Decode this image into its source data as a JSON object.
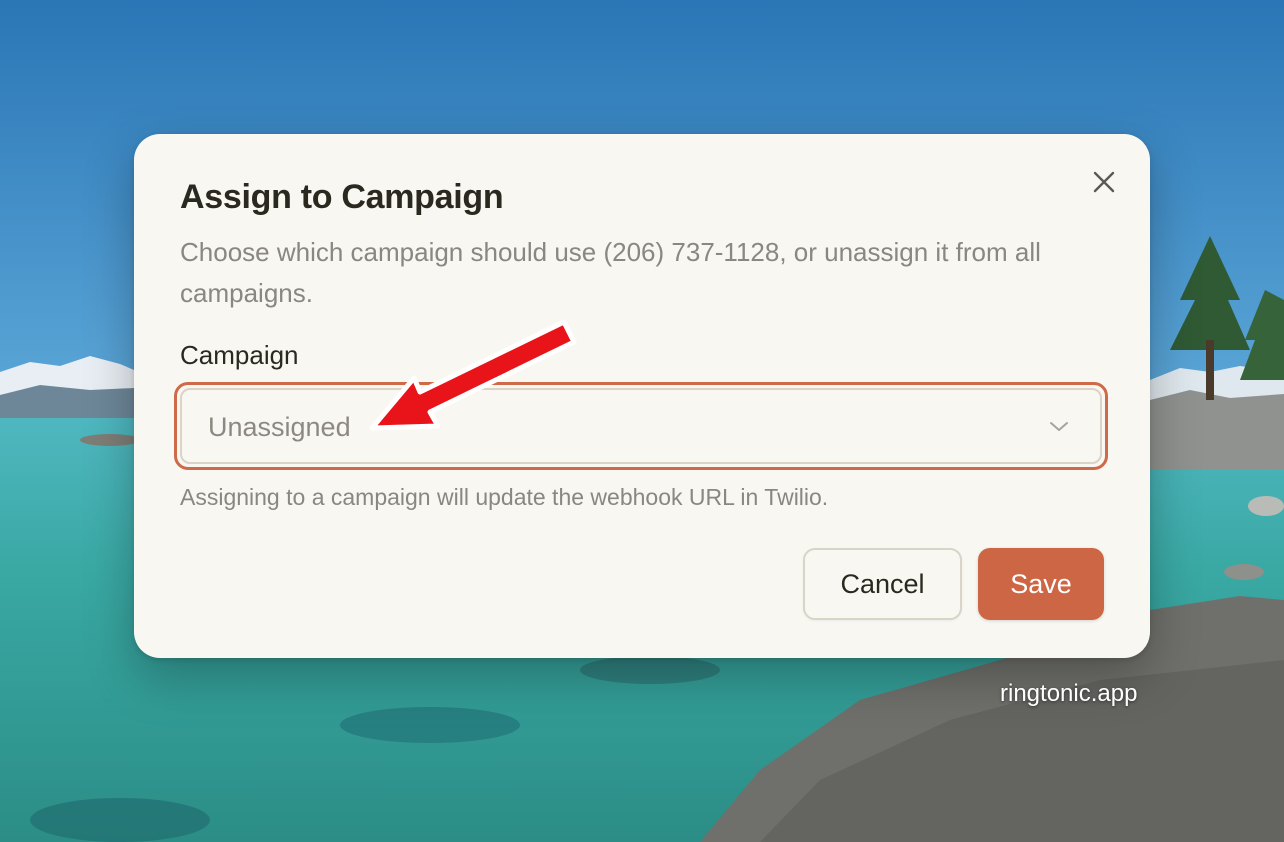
{
  "dialog": {
    "title": "Assign to Campaign",
    "description": "Choose which campaign should use (206) 737-1128, or unassign it from all campaigns.",
    "close_icon": "close-icon",
    "field_label": "Campaign",
    "select_value": "Unassigned",
    "select_icon": "chevron-down-icon",
    "hint": "Assigning to a campaign will update the webhook URL in Twilio.",
    "cancel_label": "Cancel",
    "save_label": "Save"
  },
  "watermark": "ringtonic.app",
  "colors": {
    "accent": "#cd6644",
    "focus_ring": "#cf6a48",
    "dialog_bg": "#f9f7f2",
    "annotation_arrow": "#e8141a"
  }
}
